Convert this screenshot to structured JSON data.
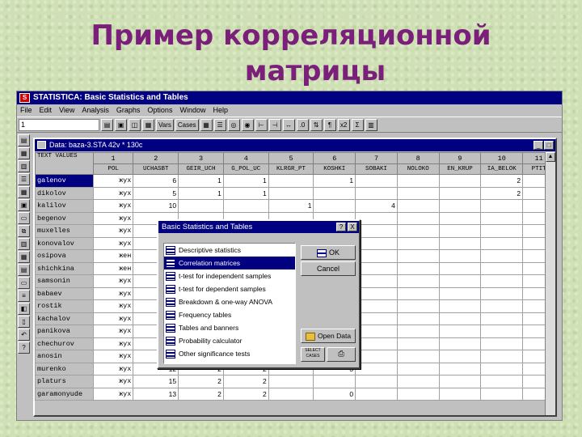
{
  "slide": {
    "title_line1": "Пример корреляционной",
    "title_line2": "матрицы"
  },
  "app": {
    "title": "STATISTICA: Basic Statistics and Tables",
    "menu": [
      "File",
      "Edit",
      "View",
      "Analysis",
      "Graphs",
      "Options",
      "Window",
      "Help"
    ],
    "toolbar": {
      "combo_value": "1",
      "vars_label": "Vars",
      "cases_label": "Cases",
      "x2_label": "x2"
    }
  },
  "datawin": {
    "title": "Data: baza-3.STA  42v * 130c",
    "corner_text": "TEXT VALUES",
    "col_numbers": [
      "1",
      "2",
      "3",
      "4",
      "5",
      "6",
      "7",
      "8",
      "9",
      "10",
      "11"
    ],
    "col_names": [
      "POL",
      "UCHASBT",
      "GEIR_UCH",
      "G_POL_UC",
      "KLRGR_PT",
      "KOSHKI",
      "SOBAKI",
      "NOLOKO",
      "EN_KRUP",
      "IA_BELOK",
      "PTIT"
    ],
    "rows": [
      {
        "name": "galenov",
        "code": "жух",
        "v": [
          "6",
          "1",
          "1",
          "",
          "1",
          "",
          "",
          "",
          "2",
          ""
        ]
      },
      {
        "name": "dikolov",
        "code": "жух",
        "v": [
          "5",
          "1",
          "1",
          "",
          "",
          "",
          "",
          "",
          "2",
          ""
        ]
      },
      {
        "name": "kalilov",
        "code": "жух",
        "v": [
          "10",
          "",
          "",
          "1",
          "",
          "4",
          "",
          "",
          "",
          ""
        ]
      },
      {
        "name": "begenov",
        "code": "жух",
        "v": [
          "",
          "",
          "",
          "",
          "",
          "",
          "",
          "",
          "",
          ""
        ]
      },
      {
        "name": "muxelles",
        "code": "жух",
        "v": [
          "",
          "",
          "",
          "",
          "",
          "",
          "",
          "",
          "",
          ""
        ]
      },
      {
        "name": "konovalov",
        "code": "жух",
        "v": [
          "",
          "",
          "",
          "",
          "",
          "",
          "",
          "",
          "",
          ""
        ]
      },
      {
        "name": "osipova",
        "code": "жен",
        "v": [
          "",
          "",
          "",
          "",
          "",
          "",
          "",
          "",
          "",
          ""
        ]
      },
      {
        "name": "shichkina",
        "code": "жен",
        "v": [
          "",
          "",
          "",
          "",
          "",
          "",
          "",
          "",
          "",
          ""
        ]
      },
      {
        "name": "samsonin",
        "code": "жух",
        "v": [
          "",
          "",
          "",
          "",
          "",
          "",
          "",
          "",
          "",
          ""
        ]
      },
      {
        "name": "babaev",
        "code": "жух",
        "v": [
          "",
          "",
          "",
          "",
          "",
          "",
          "",
          "",
          "",
          ""
        ]
      },
      {
        "name": "rostik",
        "code": "жух",
        "v": [
          "",
          "",
          "",
          "",
          "",
          "",
          "",
          "",
          "",
          ""
        ]
      },
      {
        "name": "kachalov",
        "code": "жух",
        "v": [
          "",
          "",
          "",
          "",
          "",
          "",
          "",
          "",
          "",
          ""
        ]
      },
      {
        "name": "panikova",
        "code": "жух",
        "v": [
          "",
          "",
          "",
          "",
          "",
          "",
          "",
          "",
          "",
          ""
        ]
      },
      {
        "name": "chechurov",
        "code": "жух",
        "v": [
          "",
          "",
          "",
          "",
          "",
          "",
          "",
          "",
          "",
          ""
        ]
      },
      {
        "name": "anosin",
        "code": "жух",
        "v": [
          "",
          "",
          "",
          "",
          "",
          "",
          "",
          "",
          "",
          ""
        ]
      },
      {
        "name": "murenko",
        "code": "жух",
        "v": [
          "12",
          "2",
          "2",
          "",
          "3",
          "",
          "",
          "",
          "",
          ""
        ]
      },
      {
        "name": "platurs",
        "code": "жух",
        "v": [
          "15",
          "2",
          "2",
          "",
          "",
          "",
          "",
          "",
          "",
          ""
        ]
      },
      {
        "name": "garamonyude",
        "code": "жух",
        "v": [
          "13",
          "2",
          "2",
          "",
          "0",
          "",
          "",
          "",
          "",
          ""
        ]
      }
    ]
  },
  "dialog": {
    "title": "Basic Statistics and Tables",
    "help_label": "?",
    "close_label": "X",
    "items": [
      "Descriptive statistics",
      "Correlation matrices",
      "t-test for independent samples",
      "t-test for dependent samples",
      "Breakdown & one-way ANOVA",
      "Frequency tables",
      "Tables and banners",
      "Probability calculator",
      "Other significance tests"
    ],
    "selected_index": 1,
    "ok_label": "OK",
    "cancel_label": "Cancel",
    "open_data_label": "Open Data",
    "select_cases_label": "SELECT CASES"
  }
}
